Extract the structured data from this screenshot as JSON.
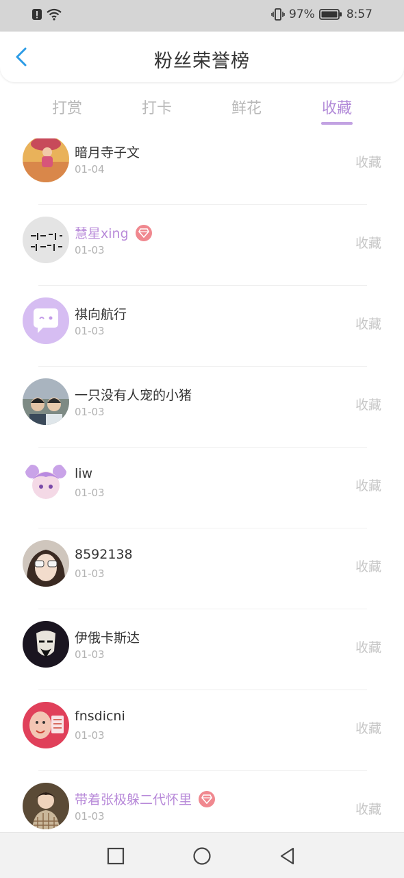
{
  "status_bar": {
    "battery": "97%",
    "time": "8:57"
  },
  "header": {
    "title": "粉丝荣誉榜"
  },
  "tabs": [
    {
      "label": "打赏"
    },
    {
      "label": "打卡"
    },
    {
      "label": "鲜花"
    },
    {
      "label": "收藏"
    }
  ],
  "active_tab": "收藏",
  "fans": [
    {
      "name": "暗月寺子文",
      "date": "01-04",
      "action": "收藏",
      "vip": false,
      "avatar": "girl-under-umbrella"
    },
    {
      "name": "慧星xing",
      "date": "01-03",
      "action": "收藏",
      "vip": true,
      "avatar": "handwriting-text"
    },
    {
      "name": "祺向航行",
      "date": "01-03",
      "action": "收藏",
      "vip": false,
      "avatar": "chat-bubble-default"
    },
    {
      "name": "一只没有人宠的小猪",
      "date": "01-03",
      "action": "收藏",
      "vip": false,
      "avatar": "two-people"
    },
    {
      "name": "liw",
      "date": "01-03",
      "action": "收藏",
      "vip": false,
      "avatar": "purple-hair-doll"
    },
    {
      "name": "8592138",
      "date": "01-03",
      "action": "收藏",
      "vip": false,
      "avatar": "girl-with-sunglasses"
    },
    {
      "name": "伊俄卡斯达",
      "date": "01-03",
      "action": "收藏",
      "vip": false,
      "avatar": "mask"
    },
    {
      "name": "fnsdicni",
      "date": "01-03",
      "action": "收藏",
      "vip": false,
      "avatar": "cartoon-baby-red"
    },
    {
      "name": "带着张极躲二代怀里",
      "date": "01-03",
      "action": "收藏",
      "vip": true,
      "avatar": "boy-plaid-shirt"
    }
  ],
  "colors": {
    "accent": "#b28ad8",
    "vip_name": "#b88ad9",
    "badge": "#f0888f",
    "muted": "#c6c6c6",
    "back_arrow": "#2b9be6"
  }
}
